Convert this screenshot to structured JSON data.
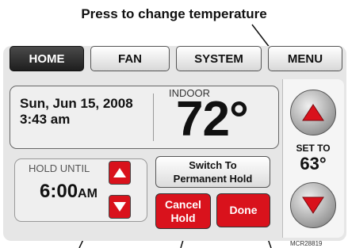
{
  "callout": {
    "top": "Press to change temperature"
  },
  "tabs": [
    {
      "label": "HOME",
      "active": true
    },
    {
      "label": "FAN",
      "active": false
    },
    {
      "label": "SYSTEM",
      "active": false
    },
    {
      "label": "MENU",
      "active": false
    }
  ],
  "info": {
    "date": "Sun, Jun 15, 2008",
    "time": "3:43 am",
    "indoor_label": "INDOOR",
    "indoor_temp": "72°"
  },
  "hold": {
    "label": "HOLD UNTIL",
    "time": "6:00",
    "ampm": "AM"
  },
  "buttons": {
    "switch_line1": "Switch To",
    "switch_line2": "Permanent Hold",
    "cancel_line1": "Cancel",
    "cancel_line2": "Hold",
    "done": "Done"
  },
  "setpoint": {
    "label": "SET TO",
    "value": "63°"
  },
  "figure_code": "MCR28819",
  "colors": {
    "accent_red": "#d9121c",
    "tab_active": "#1e1e1e"
  }
}
